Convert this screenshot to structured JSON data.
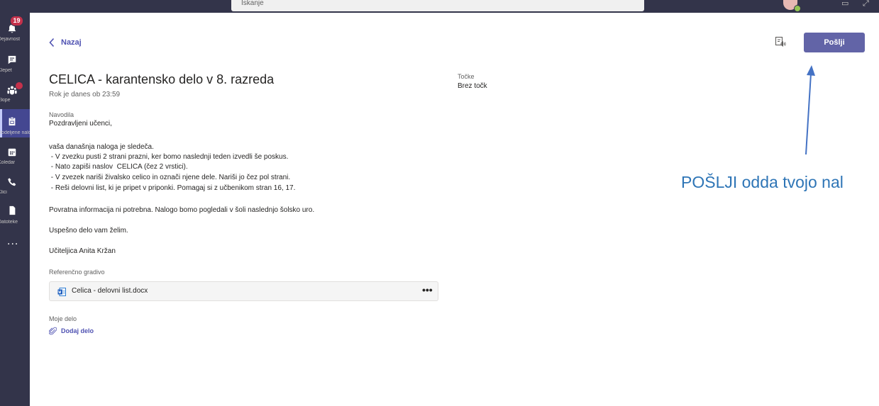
{
  "topbar": {
    "search_text": "Iskanje"
  },
  "rail": {
    "items": [
      {
        "label": "Dejavnost",
        "icon": "bell-icon",
        "badge": "19"
      },
      {
        "label": "Klepet",
        "icon": "chat-icon"
      },
      {
        "label": "Ekipe",
        "icon": "teams-icon"
      },
      {
        "label": "Dodeljene naloge",
        "icon": "assignments-icon"
      },
      {
        "label": "Koledar",
        "icon": "calendar-icon"
      },
      {
        "label": "Klici",
        "icon": "phone-icon"
      },
      {
        "label": "Datoteke",
        "icon": "file-icon"
      }
    ],
    "more": "..."
  },
  "header": {
    "back_label": "Nazaj",
    "send_label": "Pošlji"
  },
  "assignment": {
    "title": "CELICA - karantensko delo v 8. razreda",
    "due": "Rok je danes ob 23:59",
    "points_label": "Točke",
    "points_value": "Brez točk",
    "instructions_label": "Navodila",
    "instructions": [
      "Pozdravljeni učenci,",
      "vaša današnja naloga je sledeča.",
      " - V zvezku pusti 2 strani prazni, ker bomo naslednji teden izvedli še poskus.",
      " - Nato zapiši naslov  CELICA (čez 2 vrstici).",
      " - V zvezek nariši živalsko celico in označi njene dele. Nariši jo čez pol strani.",
      " - Reši delovni list, ki je pripet v priponki. Pomagaj si z učbenikom stran 16, 17.",
      "Povratna informacija ni potrebna. Nalogo bomo pogledali v šoli naslednjo šolsko uro.",
      "Uspešno delo vam želim.",
      "Učiteljica Anita Kržan"
    ],
    "reference_label": "Referenčno gradivo",
    "attachment_name": "Celica - delovni list.docx",
    "attachment_more": "•••",
    "my_work_label": "Moje delo",
    "add_work_label": "Dodaj delo"
  },
  "annotation": {
    "text": "POŠLJI odda tvojo nal",
    "color": "#2e75b6"
  },
  "colors": {
    "rail": "#33344a",
    "accent": "#6264a7",
    "link": "#4f52b2",
    "badge": "#c4314b"
  }
}
